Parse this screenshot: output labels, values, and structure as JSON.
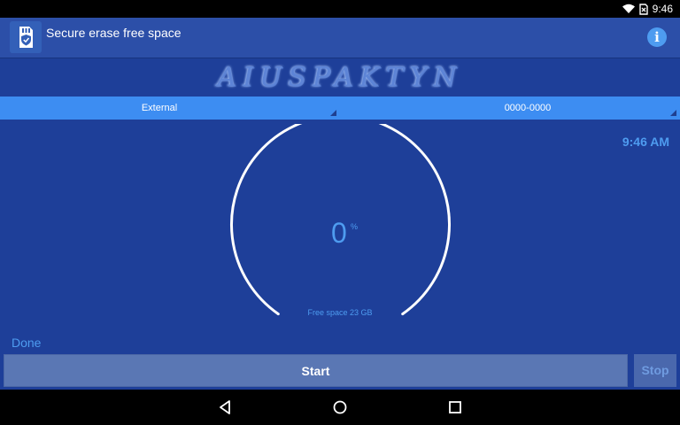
{
  "status_bar": {
    "time": "9:46",
    "icons": [
      "wifi-icon",
      "no-sim-icon"
    ]
  },
  "appbar": {
    "title": "Secure erase free space",
    "app_icon": "sd-card-shield-icon",
    "info_icon": "info-icon",
    "info_glyph": "i"
  },
  "banner": {
    "text": "AIUSPAKTYN"
  },
  "selectors": {
    "storage": "External",
    "code": "0000-0000"
  },
  "clock": "9:46 AM",
  "gauge": {
    "progress": 0,
    "value": "0",
    "unit": "%",
    "free_space": "Free space 23 GB"
  },
  "status_text": "Done",
  "buttons": {
    "start": "Start",
    "stop": "Stop"
  },
  "colors": {
    "background": "#1e3f99",
    "appbar": "#2c4fa8",
    "accent": "#4e9cf0",
    "selector": "#3d8df2"
  },
  "navbar": {
    "icons": [
      "back-icon",
      "home-icon",
      "recents-icon"
    ]
  }
}
